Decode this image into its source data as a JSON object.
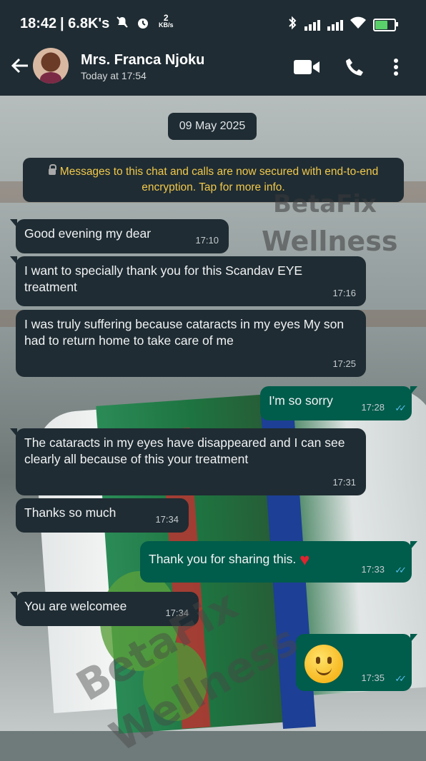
{
  "status_bar": {
    "time": "18:42",
    "net": "| 6.8K's",
    "speed_num": "2",
    "speed_unit": "KB/s",
    "battery_color": "#5ad06a"
  },
  "header": {
    "contact_name": "Mrs. Franca Njoku",
    "last_seen": "Today at 17:54",
    "icons": [
      "back-arrow-icon",
      "video-call-icon",
      "phone-icon",
      "more-vert-icon"
    ]
  },
  "chat": {
    "date": "09 May 2025",
    "encryption_notice": "Messages to this chat and calls are now secured with end-to-end encryption. Tap for more info.",
    "messages": [
      {
        "dir": "in",
        "text": "Good evening my dear",
        "time": "17:10"
      },
      {
        "dir": "in",
        "text": "I want to specially thank you for this Scandav EYE treatment",
        "time": "17:16"
      },
      {
        "dir": "in",
        "text": "I was truly suffering because cataracts in my eyes My son had to return home to take care of me",
        "time": "17:25"
      },
      {
        "dir": "out",
        "text": "I'm so sorry",
        "time": "17:28"
      },
      {
        "dir": "in",
        "text": "The cataracts in my eyes have disappeared and I can see clearly all because of this your treatment",
        "time": "17:31"
      },
      {
        "dir": "in",
        "text": "Thanks so much",
        "time": "17:34"
      },
      {
        "dir": "out",
        "text": "Thank you for sharing this. ❤️",
        "time": "17:33"
      },
      {
        "dir": "in",
        "text": "You are welcomee",
        "time": "17:34"
      },
      {
        "dir": "out",
        "text": "🙂",
        "time": "17:35"
      }
    ]
  },
  "watermark": {
    "line1": "BetaFix",
    "line2": "Wellness"
  },
  "colors": {
    "header_bg": "#1f2c33",
    "incoming_bubble": "#1f2c33",
    "outgoing_bubble": "#005c4b",
    "read_ticks": "#53bdeb",
    "encryption_text": "#f1c84b"
  }
}
